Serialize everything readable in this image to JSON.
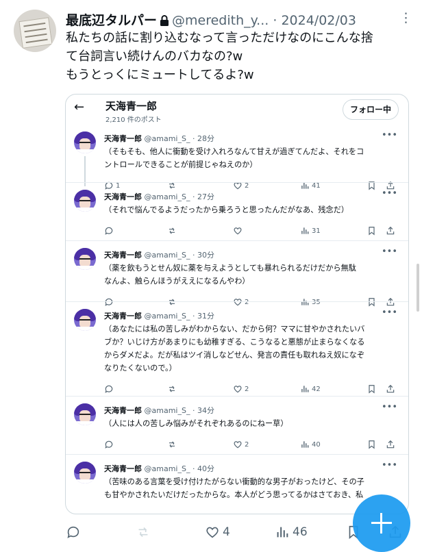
{
  "outer": {
    "name": "最底辺タルパー",
    "handle": "@meredith_y...",
    "dot": "·",
    "date": "2024/02/03",
    "more": "⋮",
    "text_lines": [
      "私たちの話に割り込むなって言っただけなのにこんな捨",
      "て台詞言い続けんのバカなの?w",
      "もうとっくにミュートしてるよ?w"
    ],
    "actions": {
      "likes": "4",
      "views": "46"
    }
  },
  "card": {
    "back": "←",
    "profile_name": "天海青一郎",
    "post_count": "2,210 件のポスト",
    "follow_label": "フォロー中",
    "posts": [
      {
        "name": "天海青一郎",
        "handle": "@amami_S_ · 28分",
        "lines": [
          "（そもそも、他人に衝動を受け入れろなんて甘えが過ぎてんだよ、それをコ",
          "ントロールできることが前提じゃねえのか）"
        ],
        "replies": "1",
        "likes": "2",
        "views": "41"
      },
      {
        "name": "天海青一郎",
        "handle": "@amami_S_ · 27分",
        "lines": [
          "（それで悩んでるようだったから乗ろうと思ったんだがなあ、残念だ）"
        ],
        "replies": "",
        "likes": "",
        "views": "31"
      },
      {
        "name": "天海青一郎",
        "handle": "@amami_S_ · 30分",
        "lines": [
          "（薬を飲もうとせん奴に薬を与えようとしても暴れられるだけだから無駄",
          "なんよ、触らんほうがええになるんやわ）"
        ],
        "replies": "",
        "likes": "2",
        "views": "35"
      },
      {
        "name": "天海青一郎",
        "handle": "@amami_S_ · 31分",
        "lines": [
          "（あなたには私の苦しみがわからない、だから何？ママに甘やかされたいバ",
          "ブか？いじけ方があまりにも幼稚すぎる、こうなると悪態が止まらなくなる",
          "からダメだよ。だが私はツイ消しなどせん、発言の責任も取れねえ奴になぞ",
          "なりたくないので。）"
        ],
        "replies": "",
        "likes": "2",
        "views": "42"
      },
      {
        "name": "天海青一郎",
        "handle": "@amami_S_ · 34分",
        "lines": [
          "（人には人の苦しみ悩みがそれぞれあるのにねー草）"
        ],
        "replies": "",
        "likes": "2",
        "views": "40"
      },
      {
        "name": "天海青一郎",
        "handle": "@amami_S_ · 40分",
        "lines": [
          "（苦味のある言葉を受け付けたがらない衝動的な男子がおったけど、その子",
          "も甘やかされたいだけだったからな。本人がどう思ってるかはさておき、私"
        ],
        "replies": "",
        "likes": "",
        "views": ""
      }
    ]
  },
  "colors": {
    "accent": "#1d9bf0",
    "muted": "#536471",
    "border": "#cfd9de"
  }
}
